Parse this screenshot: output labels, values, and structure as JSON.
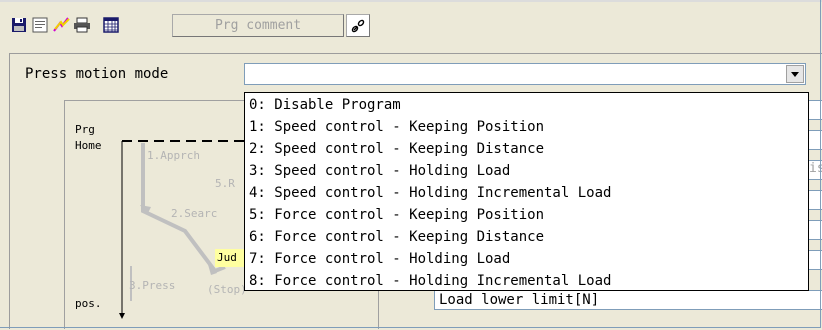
{
  "toolbar": {
    "buttons": [
      "save-icon",
      "document-icon",
      "lightning-icon",
      "print-icon",
      "table-icon"
    ],
    "prg_comment_label": "Prg comment",
    "link_icon": "link-icon"
  },
  "press_motion": {
    "label": "Press motion mode",
    "value": "",
    "options": [
      "0: Disable Program",
      "1: Speed control - Keeping Position",
      "2: Speed control - Keeping Distance",
      "3: Speed control - Holding Load",
      "4: Speed control - Holding Incremental Load",
      "5: Force control - Keeping Position",
      "6: Force control - Keeping Distance",
      "7: Force control - Holding Load",
      "8: Force control - Holding Incremental Load"
    ]
  },
  "diagram": {
    "prg": "Prg",
    "home": "Home",
    "pos": "pos.",
    "step1": "1.Apprch",
    "step5": "5.R",
    "step2": "2.Searc",
    "judge": "Jud",
    "step3": "3.Press",
    "stop": "(Stop)"
  },
  "right_panel": {
    "partial_text": "is",
    "load_lower_limit": "Load lower limit[N]"
  },
  "colors": {
    "background": "#ece9d8",
    "field_border": "#7f9db9",
    "diagram_path": "#c0c0c0",
    "judge_highlight": "#ffffa0"
  }
}
